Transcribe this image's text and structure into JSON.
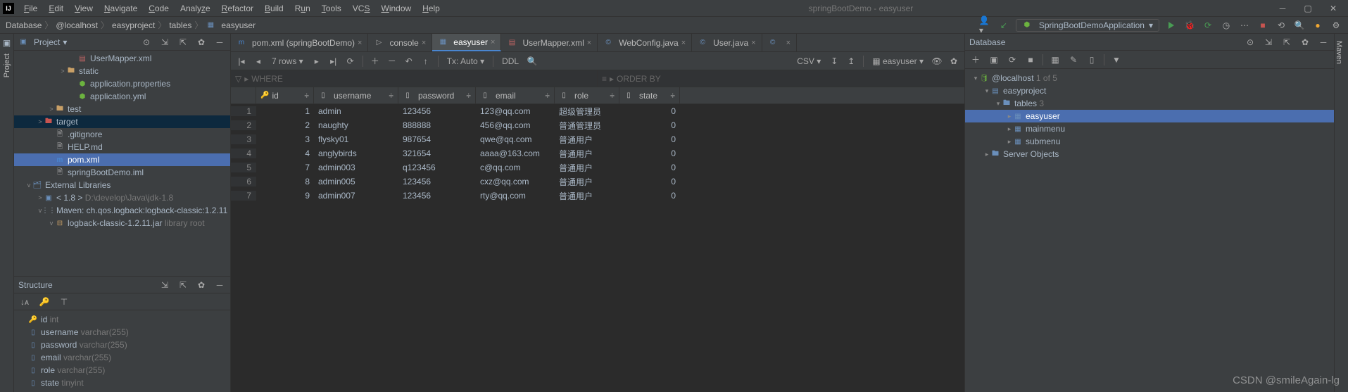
{
  "window": {
    "title": "springBootDemo - easyuser"
  },
  "menu": [
    "File",
    "Edit",
    "View",
    "Navigate",
    "Code",
    "Analyze",
    "Refactor",
    "Build",
    "Run",
    "Tools",
    "VCS",
    "Window",
    "Help"
  ],
  "breadcrumbs": [
    "Database",
    "@localhost",
    "easyproject",
    "tables",
    "easyuser"
  ],
  "run_config": "SpringBootDemoApplication",
  "project_panel": {
    "title": "Project",
    "items": [
      {
        "indent": 5,
        "icon": "xml",
        "label": "UserMapper.xml"
      },
      {
        "indent": 4,
        "arrow": ">",
        "icon": "folder",
        "label": "static"
      },
      {
        "indent": 5,
        "icon": "yml",
        "label": "application.properties"
      },
      {
        "indent": 5,
        "icon": "yml",
        "label": "application.yml"
      },
      {
        "indent": 3,
        "arrow": ">",
        "icon": "folder",
        "label": "test"
      },
      {
        "indent": 2,
        "arrow": ">",
        "icon": "folder-red",
        "label": "target",
        "selected": true
      },
      {
        "indent": 3,
        "icon": "txt",
        "label": ".gitignore"
      },
      {
        "indent": 3,
        "icon": "txt",
        "label": "HELP.md"
      },
      {
        "indent": 3,
        "icon": "m",
        "label": "pom.xml",
        "highlight": true
      },
      {
        "indent": 3,
        "icon": "txt",
        "label": "springBootDemo.iml"
      },
      {
        "indent": 1,
        "arrow": "v",
        "icon": "lib",
        "label": "External Libraries"
      },
      {
        "indent": 2,
        "arrow": ">",
        "icon": "jdk",
        "label": "< 1.8 >",
        "suffix": "D:\\develop\\Java\\jdk-1.8"
      },
      {
        "indent": 2,
        "arrow": "v",
        "icon": "mvn",
        "label": "Maven: ch.qos.logback:logback-classic:1.2.11"
      },
      {
        "indent": 3,
        "arrow": "v",
        "icon": "jar",
        "label": "logback-classic-1.2.11.jar",
        "suffix": "library root"
      }
    ]
  },
  "structure_panel": {
    "title": "Structure",
    "items": [
      {
        "label": "id",
        "type": "int",
        "key": true
      },
      {
        "label": "username",
        "type": "varchar(255)"
      },
      {
        "label": "password",
        "type": "varchar(255)"
      },
      {
        "label": "email",
        "type": "varchar(255)"
      },
      {
        "label": "role",
        "type": "varchar(255)"
      },
      {
        "label": "state",
        "type": "tinyint"
      }
    ]
  },
  "tabs": [
    {
      "icon": "m",
      "label": "pom.xml (springBootDemo)"
    },
    {
      "icon": "console",
      "label": "console"
    },
    {
      "icon": "table",
      "label": "easyuser",
      "active": true
    },
    {
      "icon": "xml",
      "label": "UserMapper.xml"
    },
    {
      "icon": "java",
      "label": "WebConfig.java"
    },
    {
      "icon": "java",
      "label": "User.java"
    },
    {
      "icon": "java",
      "label": ""
    }
  ],
  "db_toolbar": {
    "rows_label": "7 rows",
    "tx_label": "Tx: Auto",
    "ddl": "DDL",
    "csv": "CSV",
    "schema": "easyuser"
  },
  "filters": {
    "where": "WHERE",
    "order": "ORDER BY"
  },
  "grid": {
    "columns": [
      "id",
      "username",
      "password",
      "email",
      "role",
      "state"
    ],
    "rows": [
      {
        "n": 1,
        "id": 1,
        "username": "admin",
        "password": "123456",
        "email": "123@qq.com",
        "role": "超级管理员",
        "state": 0
      },
      {
        "n": 2,
        "id": 2,
        "username": "naughty",
        "password": "888888",
        "email": "456@qq.com",
        "role": "普通管理员",
        "state": 0
      },
      {
        "n": 3,
        "id": 3,
        "username": "flysky01",
        "password": "987654",
        "email": "qwe@qq.com",
        "role": "普通用户",
        "state": 0
      },
      {
        "n": 4,
        "id": 4,
        "username": "anglybirds",
        "password": "321654",
        "email": "aaaa@163.com",
        "role": "普通用户",
        "state": 0
      },
      {
        "n": 5,
        "id": 7,
        "username": "admin003",
        "password": "q123456",
        "email": "c@qq.com",
        "role": "普通用户",
        "state": 0
      },
      {
        "n": 6,
        "id": 8,
        "username": "admin005",
        "password": "123456",
        "email": "cxz@qq.com",
        "role": "普通用户",
        "state": 0
      },
      {
        "n": 7,
        "id": 9,
        "username": "admin007",
        "password": "123456",
        "email": "rty@qq.com",
        "role": "普通用户",
        "state": 0
      }
    ]
  },
  "database_panel": {
    "title": "Database",
    "host": "@localhost",
    "host_suffix": "1 of 5",
    "project": "easyproject",
    "tables_label": "tables",
    "tables_count": "3",
    "tables": [
      "easyuser",
      "mainmenu",
      "submenu"
    ],
    "server_objects": "Server Objects"
  },
  "sidebars": {
    "left": "Project",
    "right": "Maven"
  },
  "watermark": "CSDN @smileAgain-lg"
}
